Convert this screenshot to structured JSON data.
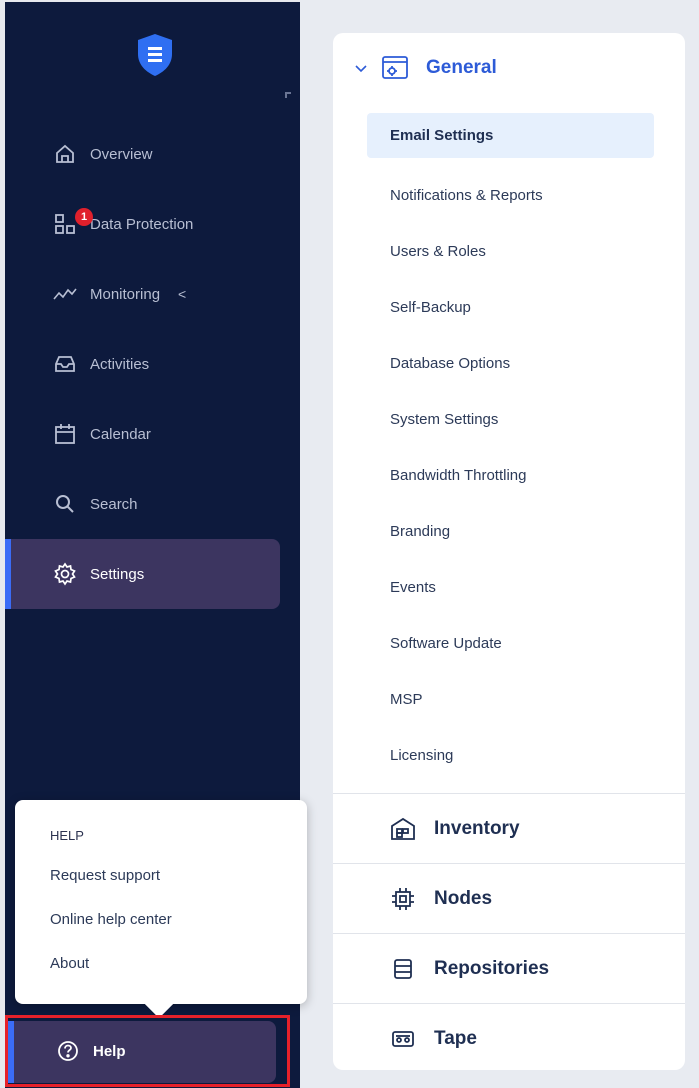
{
  "sidebar": {
    "logo_icon": "shield-menu-icon",
    "items": [
      {
        "label": "Overview",
        "icon": "home-icon"
      },
      {
        "label": "Data Protection",
        "icon": "grid-icon",
        "badge": "1"
      },
      {
        "label": "Monitoring",
        "icon": "pulse-icon",
        "chevron": "<"
      },
      {
        "label": "Activities",
        "icon": "inbox-icon"
      },
      {
        "label": "Calendar",
        "icon": "calendar-icon"
      },
      {
        "label": "Search",
        "icon": "search-icon"
      },
      {
        "label": "Settings",
        "icon": "gear-icon",
        "active": true
      }
    ]
  },
  "help_popover": {
    "title": "HELP",
    "items": [
      "Request support",
      "Online help center",
      "About"
    ]
  },
  "help_button": {
    "label": "Help",
    "icon": "help-circle-icon"
  },
  "settings_panel": {
    "general": {
      "label": "General",
      "items": [
        "Email Settings",
        "Notifications & Reports",
        "Users & Roles",
        "Self-Backup",
        "Database Options",
        "System Settings",
        "Bandwidth Throttling",
        "Branding",
        "Events",
        "Software Update",
        "MSP",
        "Licensing"
      ],
      "selected": "Email Settings"
    },
    "sections": [
      {
        "label": "Inventory",
        "icon": "inventory-icon"
      },
      {
        "label": "Nodes",
        "icon": "chip-icon"
      },
      {
        "label": "Repositories",
        "icon": "storage-icon"
      },
      {
        "label": "Tape",
        "icon": "tape-icon"
      }
    ]
  },
  "colors": {
    "sidebar_bg": "#0d1a3d",
    "active_bg": "#3c3560",
    "accent": "#2d5bd7",
    "badge": "#e0202c",
    "highlight_border": "#e6212a"
  }
}
